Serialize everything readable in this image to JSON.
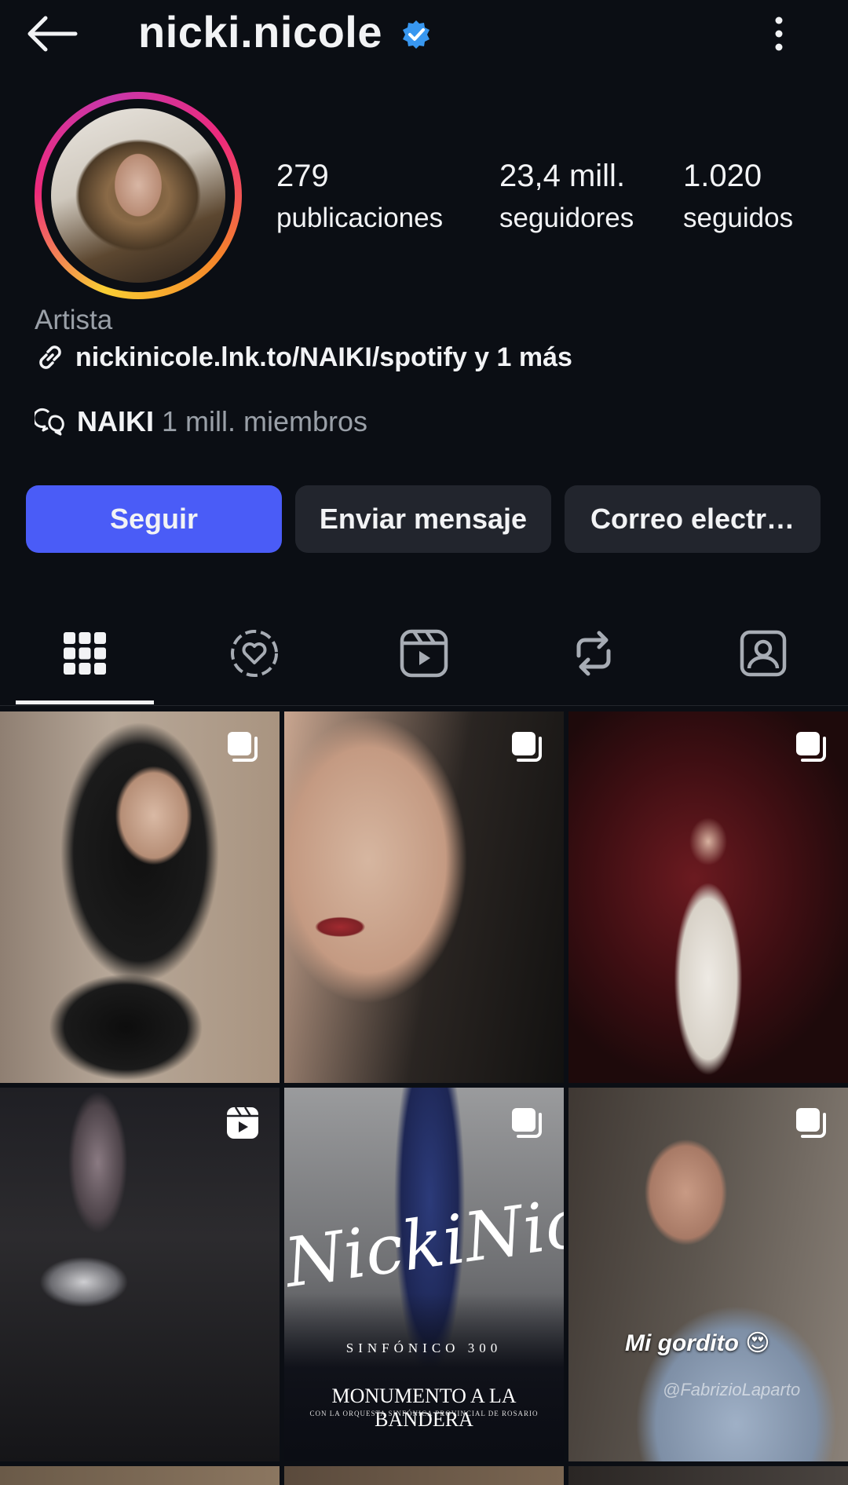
{
  "header": {
    "username": "nicki.nicole",
    "back_icon": "arrow-left-icon",
    "verified_icon": "verified-badge-icon",
    "menu_icon": "more-vertical-icon"
  },
  "stats": [
    {
      "value": "279",
      "label": "publicaciones"
    },
    {
      "value": "23,4 mill.",
      "label": "seguidores"
    },
    {
      "value": "1.020",
      "label": "seguidos"
    }
  ],
  "bio": {
    "category": "Artista",
    "link": "nickinicole.lnk.to/NAIKI/spotify y 1 más",
    "channel_name": "NAIKI",
    "channel_members": "1 mill. miembros"
  },
  "actions": {
    "follow": "Seguir",
    "message": "Enviar mensaje",
    "email": "Correo electr…"
  },
  "tabs": [
    "grid-icon",
    "collab-heart-icon",
    "reels-icon",
    "reposts-icon",
    "tagged-icon"
  ],
  "posts": [
    {
      "type": "carousel"
    },
    {
      "type": "carousel"
    },
    {
      "type": "carousel"
    },
    {
      "type": "reel"
    },
    {
      "type": "carousel",
      "title": "NickiNicole",
      "subtitle": "SINFÓNICO 300",
      "headline": "MONUMENTO A LA BANDERA",
      "footnote": "CON LA ORQUESTA SINFÓNICA PROVINCIAL DE ROSARIO"
    },
    {
      "type": "carousel",
      "caption": "Mi gordito 😍",
      "credit": "@FabrizioLaparto"
    }
  ],
  "colors": {
    "accent": "#4a5cf7",
    "background": "#0b0e14",
    "button": "#22252d",
    "verified": "#3897f0"
  }
}
